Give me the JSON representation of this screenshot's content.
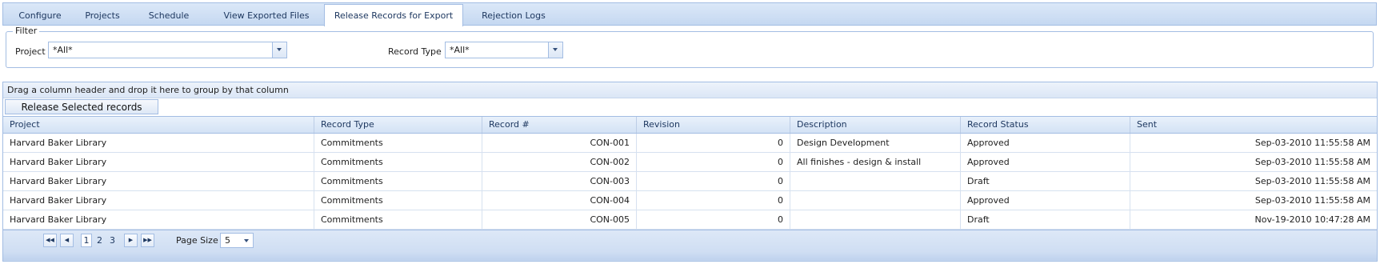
{
  "tabs": [
    {
      "label": "Configure",
      "active": false
    },
    {
      "label": "Projects",
      "active": false
    },
    {
      "label": "Schedule",
      "active": false
    },
    {
      "label": "View Exported Files",
      "active": false
    },
    {
      "label": "Release Records for Export",
      "active": true
    },
    {
      "label": "Rejection Logs",
      "active": false
    }
  ],
  "filter": {
    "legend": "Filter",
    "project_label": "Project",
    "project_value": "*All*",
    "record_type_label": "Record Type",
    "record_type_value": "*All*"
  },
  "grid": {
    "group_panel_text": "Drag a column header and drop it here to group by that column",
    "release_button": "Release Selected records",
    "columns": [
      "Project",
      "Record Type",
      "Record #",
      "Revision",
      "Description",
      "Record Status",
      "Sent"
    ],
    "rows": [
      [
        "Harvard Baker Library",
        "Commitments",
        "CON-001",
        "0",
        "Design Development",
        "Approved",
        "Sep-03-2010 11:55:58 AM"
      ],
      [
        "Harvard Baker Library",
        "Commitments",
        "CON-002",
        "0",
        "All finishes - design & install",
        "Approved",
        "Sep-03-2010 11:55:58 AM"
      ],
      [
        "Harvard Baker Library",
        "Commitments",
        "CON-003",
        "0",
        "",
        "Draft",
        "Sep-03-2010 11:55:58 AM"
      ],
      [
        "Harvard Baker Library",
        "Commitments",
        "CON-004",
        "0",
        "",
        "Approved",
        "Sep-03-2010 11:55:58 AM"
      ],
      [
        "Harvard Baker Library",
        "Commitments",
        "CON-005",
        "0",
        "",
        "Draft",
        "Nov-19-2010 10:47:28 AM"
      ]
    ]
  },
  "pager": {
    "pages": [
      "1",
      "2",
      "3"
    ],
    "current_page": "1",
    "page_size_label": "Page Size",
    "page_size_value": "5"
  },
  "colors": {
    "accent_border": "#a3bde3",
    "header_text": "#1e3860"
  },
  "icons": {
    "first": "first-page-icon",
    "prev": "prev-page-icon",
    "next": "next-page-icon",
    "last": "last-page-icon",
    "dropdown": "chevron-down-icon"
  }
}
